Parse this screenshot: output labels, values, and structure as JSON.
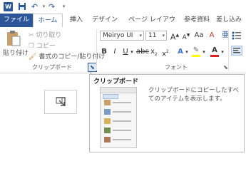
{
  "tabs": {
    "file": "ファイル",
    "home": "ホーム",
    "insert": "挿入",
    "design": "デザイン",
    "layout": "ページ レイアウト",
    "references": "参考資料",
    "mailings": "差し込み"
  },
  "clipboard": {
    "paste": "貼り付け",
    "cut": "切り取り",
    "copy": "コピー",
    "format_painter": "書式のコピー/貼り付け",
    "group_label": "クリップボード"
  },
  "font": {
    "name": "Meiryo UI",
    "size": "11",
    "group_label": "フォント"
  },
  "tooltip": {
    "title": "クリップボード",
    "description": "クリップボードにコピーしたすべてのアイテムを表示します。"
  },
  "colors": {
    "accent": "#2b579a",
    "highlight": "#ffff00",
    "font_color": "#e02020"
  }
}
